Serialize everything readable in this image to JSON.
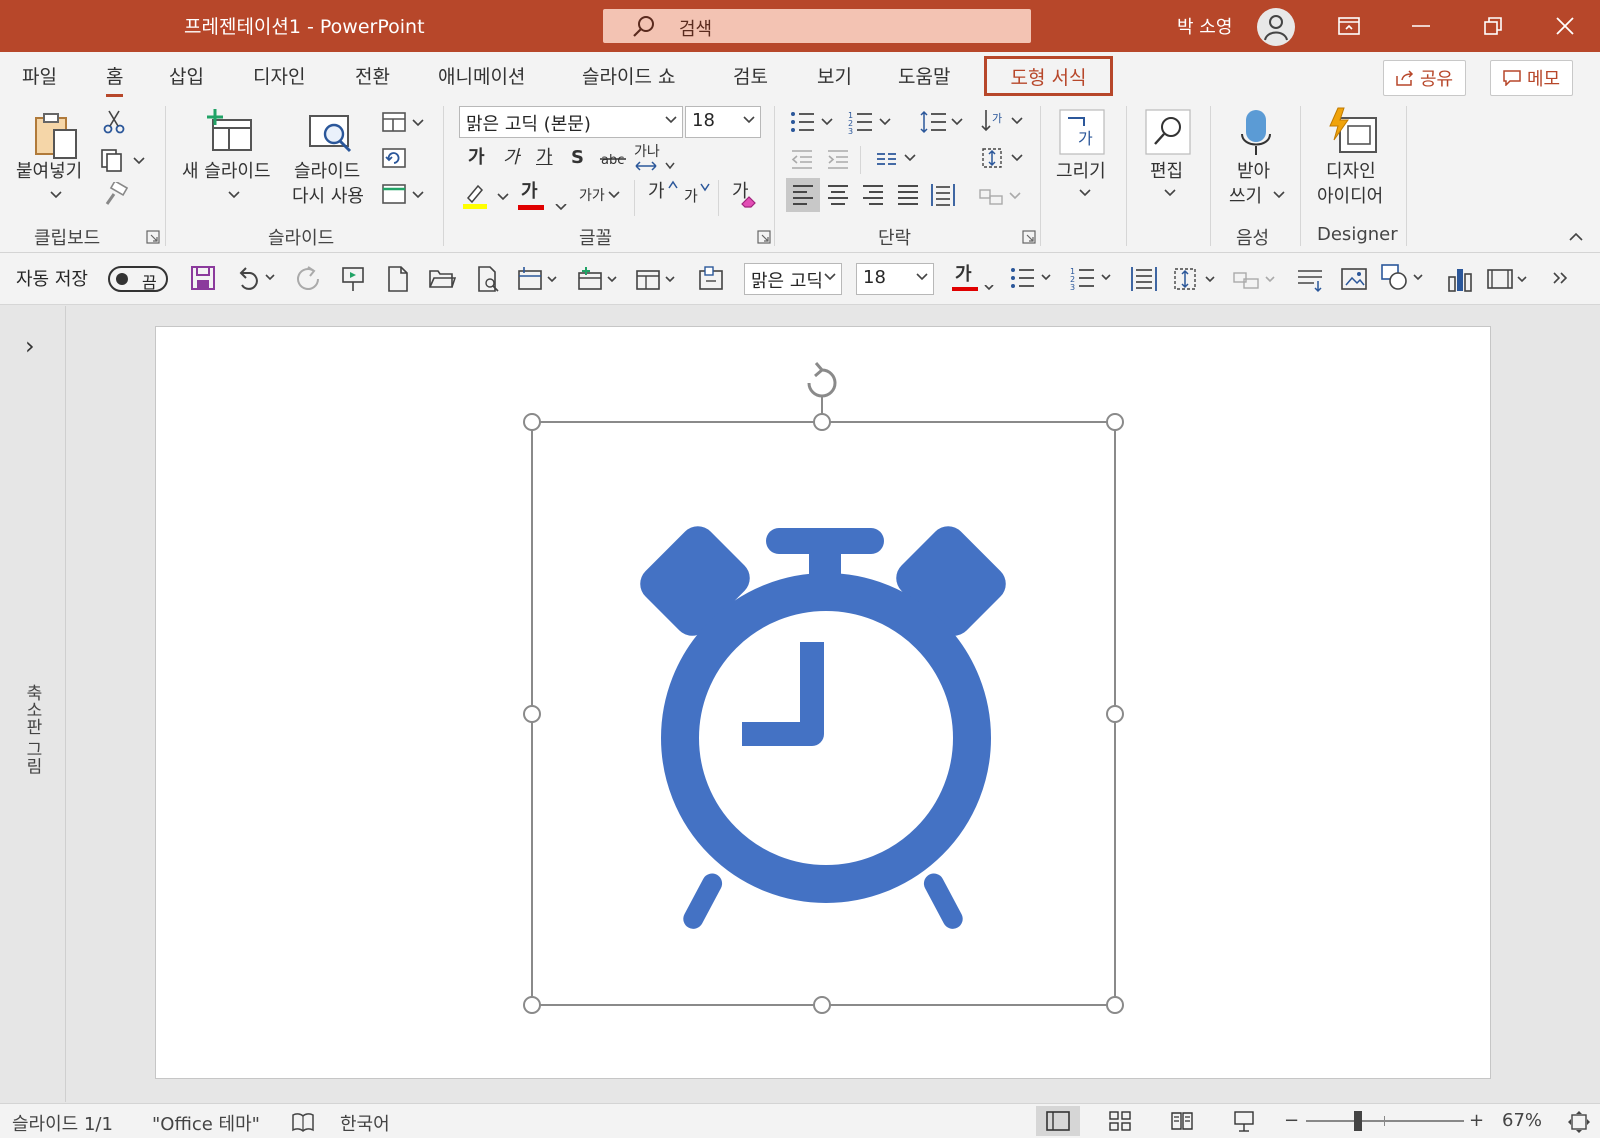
{
  "window": {
    "title": "프레젠테이션1  -  PowerPoint",
    "search_placeholder": "검색",
    "user_name": "박 소영"
  },
  "tabs": [
    "파일",
    "홈",
    "삽입",
    "디자인",
    "전환",
    "애니메이션",
    "슬라이드 쇼",
    "검토",
    "보기",
    "도움말",
    "도형 서식"
  ],
  "active_tab": "홈",
  "highlighted_tab": "도형 서식",
  "top_buttons": {
    "share": "공유",
    "comment": "메모"
  },
  "ribbon": {
    "clipboard": {
      "label": "클립보드",
      "paste": "붙여넣기"
    },
    "slides": {
      "label": "슬라이드",
      "new_slide": "새 슬라이드",
      "reuse_line1": "슬라이드",
      "reuse_line2": "다시 사용"
    },
    "font": {
      "label": "글꼴",
      "font_name": "맑은 고딕 (본문)",
      "font_size": "18",
      "bold": "가",
      "italic": "가",
      "underline": "가",
      "strike": "S",
      "spacing": "가나",
      "grow": "가",
      "shrink": "가",
      "case": "가가",
      "color": "가",
      "clear": "가"
    },
    "paragraph": {
      "label": "단락"
    },
    "drawing": {
      "label": "그리기"
    },
    "editing": {
      "label": "편집"
    },
    "voice": {
      "label": "음성",
      "dictate_line1": "받아",
      "dictate_line2": "쓰기"
    },
    "designer": {
      "label": "Designer",
      "ideas_line1": "디자인",
      "ideas_line2": "아이디어"
    }
  },
  "qat": {
    "autosave_label": "자동 저장",
    "autosave_state": "끔",
    "font_name": "맑은 고딕",
    "font_size": "18",
    "font_color_glyph": "가"
  },
  "left_pane": {
    "label": "축소판 그림",
    "expand": "›"
  },
  "status": {
    "slide_indicator": "슬라이드 1/1",
    "theme": "\"Office 테마\"",
    "language": "한국어",
    "zoom": "67%",
    "zoom_minus": "−",
    "zoom_plus": "+"
  },
  "colors": {
    "accent": "#b7472a",
    "icon_blue": "#4472c4",
    "ribbon_bg": "#f3f3f3"
  },
  "slide": {
    "selected_shape_icon": "alarm-clock-icon"
  }
}
